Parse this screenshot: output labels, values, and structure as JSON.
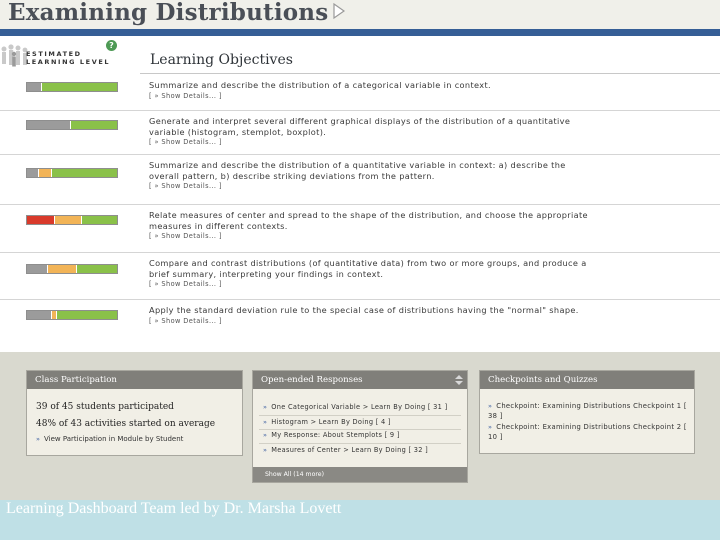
{
  "header": {
    "title": "Examining Distributions"
  },
  "sidebar": {
    "estimated_label": "ESTIMATED\nLEARNING LEVEL",
    "help_glyph": "?"
  },
  "objectives": {
    "title": "Learning Objectives",
    "show_details_label": "[ » Show Details... ]",
    "items": [
      {
        "text": "Summarize and describe the distribution of a categorical variable in context.",
        "meter": [
          {
            "color": "#9b9b9b",
            "fraction": 0.15
          },
          {
            "color": "#8ac149",
            "fraction": 0.85
          }
        ]
      },
      {
        "text": "Generate and interpret several different graphical displays of the distribution of a quantitative variable (histogram, stemplot, boxplot).",
        "meter": [
          {
            "color": "#9b9b9b",
            "fraction": 0.48
          },
          {
            "color": "#8ac149",
            "fraction": 0.52
          }
        ]
      },
      {
        "text": "Summarize and describe the distribution of a quantitative variable in context: a) describe the overall pattern, b) describe striking deviations from the pattern.",
        "meter": [
          {
            "color": "#9b9b9b",
            "fraction": 0.12
          },
          {
            "color": "#f2b457",
            "fraction": 0.15
          },
          {
            "color": "#8ac149",
            "fraction": 0.73
          }
        ]
      },
      {
        "text": "Relate measures of center and spread to the shape of the distribution, and choose the appropriate measures in different contexts.",
        "meter": [
          {
            "color": "#d93a2b",
            "fraction": 0.3
          },
          {
            "color": "#f2b457",
            "fraction": 0.3
          },
          {
            "color": "#8ac149",
            "fraction": 0.4
          }
        ]
      },
      {
        "text": "Compare and contrast distributions (of quantitative data) from two or more groups, and produce a brief summary, interpreting your findings in context.",
        "meter": [
          {
            "color": "#9b9b9b",
            "fraction": 0.22
          },
          {
            "color": "#f2b457",
            "fraction": 0.33
          },
          {
            "color": "#8ac149",
            "fraction": 0.45
          }
        ]
      },
      {
        "text": "Apply the standard deviation rule to the special case of distributions having the \"normal\" shape.",
        "meter": [
          {
            "color": "#9b9b9b",
            "fraction": 0.27
          },
          {
            "color": "#f2b457",
            "fraction": 0.05
          },
          {
            "color": "#8ac149",
            "fraction": 0.68
          }
        ]
      }
    ]
  },
  "participation": {
    "title": "Class Participation",
    "students": "39 of 45 students participated",
    "activities": "48% of 43 activities started on average",
    "view_link": "View Participation in Module by Student"
  },
  "responses": {
    "title": "Open-ended Responses",
    "items": [
      "One Categorical Variable > Learn By Doing [ 31 ]",
      "Histogram > Learn By Doing [ 4 ]",
      "My Response: About Stemplots [ 9 ]",
      "Measures of Center > Learn By Doing [ 32 ]"
    ],
    "show_all": "Show All (14 more)"
  },
  "checkpoints": {
    "title": "Checkpoints and Quizzes",
    "items": [
      "Checkpoint: Examining Distributions Checkpoint 1 [ 38 ]",
      "Checkpoint: Examining Distributions Checkpoint 2 [ 10 ]"
    ]
  },
  "footer": {
    "credit": "Learning Dashboard Team led by Dr. Marsha Lovett"
  },
  "colors": {
    "header_rule": "#355e96",
    "meter_green": "#8ac149",
    "meter_orange": "#f2b457",
    "meter_red": "#d93a2b",
    "meter_gray": "#9b9b9b",
    "footer_bg": "#bfe0e6"
  }
}
